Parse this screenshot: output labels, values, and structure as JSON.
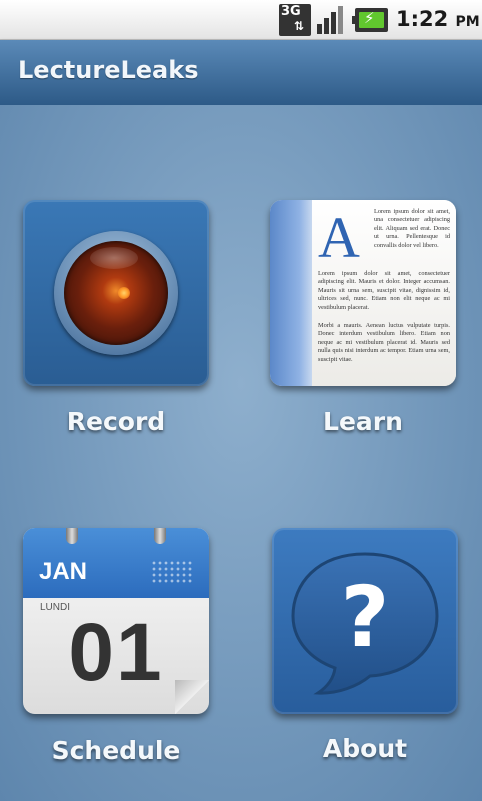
{
  "status_bar": {
    "network": "3G",
    "time": "1:22",
    "ampm": "PM",
    "icons": [
      "3g-data-icon",
      "signal-strength-icon",
      "battery-charging-icon"
    ]
  },
  "app": {
    "title": "LectureLeaks"
  },
  "tiles": [
    {
      "label": "Record",
      "icon": "record-lens-icon"
    },
    {
      "label": "Learn",
      "icon": "book-icon"
    },
    {
      "label": "Schedule",
      "icon": "calendar-icon"
    },
    {
      "label": "About",
      "icon": "question-bubble-icon"
    }
  ],
  "learn_icon": {
    "initial": "A",
    "para1": "Lorem ipsum dolor sit amet, una consectetuer adipiscing elit. Aliquam sed erat. Donec ut urna. Pellentesque id convallis dolor vel libero.",
    "para2": "Lorem ipsum dolor sit amet, consectetuer adipiscing elit. Mauris et dolor. Integer accumsan. Mauris sit urna sem, suscipit vitae, dignissim id, ultrices sed, nunc. Etiam non elit neque ac mi vestibulum placerat.",
    "para3": "Morbi a mauris. Aenean luctus vulputate turpis. Donec interdum vestibulum libero. Etiam non neque ac mi vestibulum placerat id. Mauris sed nulla quis nisi interdum ac tempor. Etiam urna sem, suscipit vitae."
  },
  "schedule_icon": {
    "month": "JAN",
    "weekday": "LUNDI",
    "day": "01"
  },
  "about_icon": {
    "glyph": "?"
  }
}
